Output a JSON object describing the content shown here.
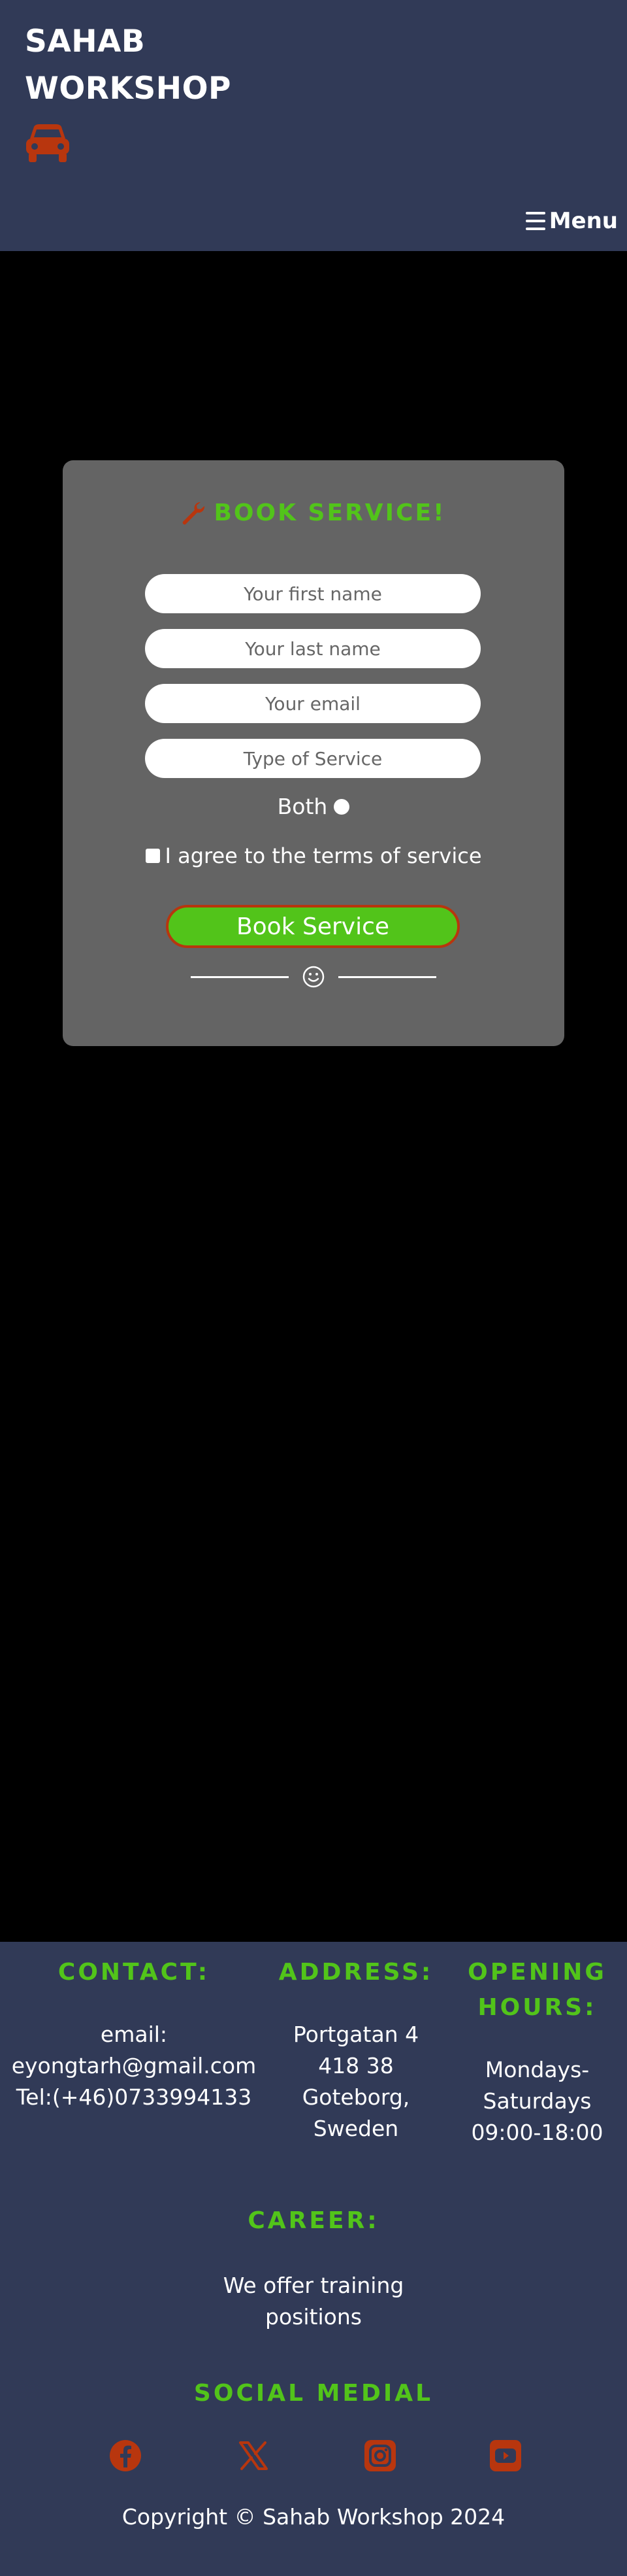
{
  "header": {
    "brand_line1": "SAHAB",
    "brand_line2": "WORKSHOP",
    "brand_icon": "car-icon",
    "menu_label": "Menu",
    "menu_icon": "hamburger-icon",
    "background": "#313a57"
  },
  "booking": {
    "title": "BOOK SERVICE!",
    "title_icon": "wrench-icon",
    "first_name_placeholder": "Your first name",
    "last_name_placeholder": "Your last name",
    "email_placeholder": "Your email",
    "service_placeholder": "Type of Service",
    "radio_label": "Both",
    "terms_label": "I agree to the terms of service",
    "submit_label": "Book Service",
    "divider_icon": "smiley-icon",
    "card_color": "#646464"
  },
  "footer": {
    "contact": {
      "heading": "CONTACT:",
      "email_label": "email:",
      "email": "eyongtarh@gmail.com",
      "phone": "Tel:(+46)0733994133"
    },
    "address": {
      "heading": "ADDRESS:",
      "line1": "Portgatan 4",
      "line2": "418 38",
      "line3": "Goteborg,",
      "line4": "Sweden"
    },
    "hours": {
      "heading_line1": "OPENING",
      "heading_line2": "HOURS:",
      "line1": "Mondays-",
      "line2": "Saturdays",
      "line3": "09:00-18:00"
    },
    "career": {
      "heading": "CAREER:",
      "line1": "We offer training",
      "line2": "positions"
    },
    "social": {
      "heading": "SOCIAL MEDIAL",
      "icons": [
        "facebook-icon",
        "x-icon",
        "instagram-icon",
        "youtube-icon"
      ]
    },
    "copyright": "Copyright © Sahab Workshop 2024"
  },
  "colors": {
    "accent_green": "#52c41a",
    "accent_orange": "#b8360e",
    "nav_bg": "#313a57",
    "page_bg": "#000000"
  }
}
